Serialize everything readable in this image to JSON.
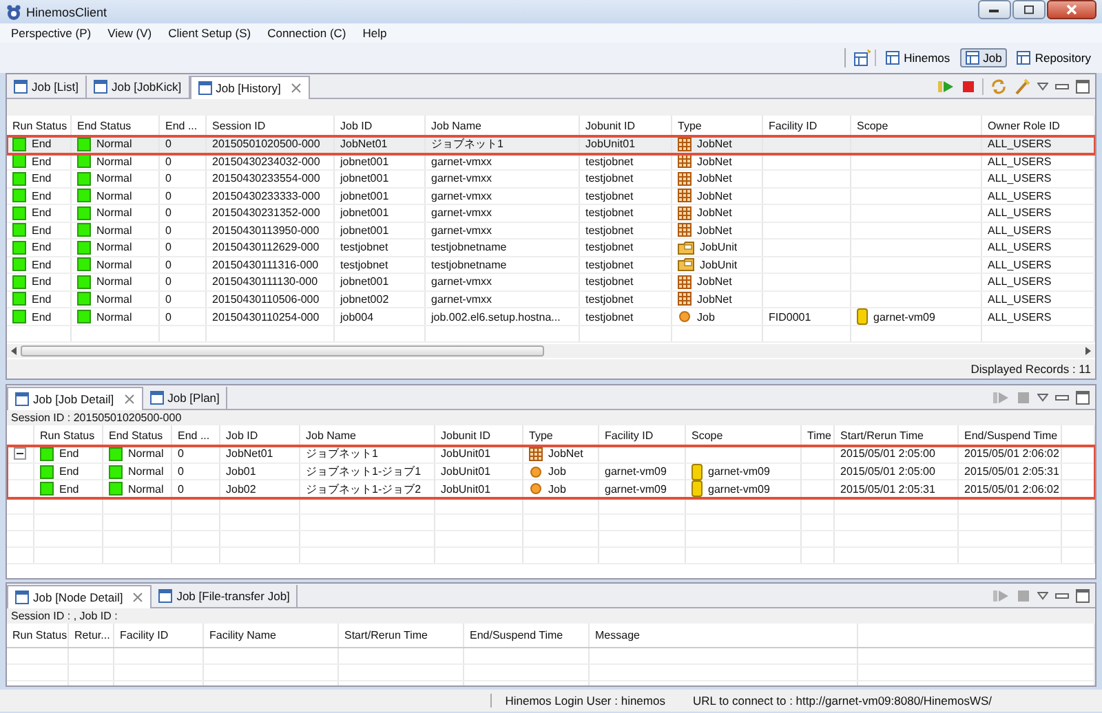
{
  "window": {
    "title": "HinemosClient"
  },
  "menu": [
    "Perspective (P)",
    "View (V)",
    "Client Setup (S)",
    "Connection (C)",
    "Help"
  ],
  "perspectives": [
    {
      "label": "Hinemos",
      "selected": false
    },
    {
      "label": "Job",
      "selected": true
    },
    {
      "label": "Repository",
      "selected": false
    }
  ],
  "history": {
    "tabs": [
      {
        "label": "Job [List]",
        "selected": false
      },
      {
        "label": "Job [JobKick]",
        "selected": false
      },
      {
        "label": "Job [History]",
        "selected": true
      }
    ],
    "columns": [
      "Run Status",
      "End Status",
      "End ...",
      "Session ID",
      "Job ID",
      "Job Name",
      "Jobunit ID",
      "Type",
      "Facility ID",
      "Scope",
      "Owner Role ID"
    ],
    "rows": [
      {
        "run_status": "End",
        "end_status": "Normal",
        "end_value": "0",
        "session_id": "20150501020500-000",
        "job_id": "JobNet01",
        "job_name": "ジョブネット1",
        "jobunit_id": "JobUnit01",
        "kind": "jobnet",
        "type": "JobNet",
        "owner_role_id": "ALL_USERS",
        "selected": true
      },
      {
        "run_status": "End",
        "end_status": "Normal",
        "end_value": "0",
        "session_id": "20150430234032-000",
        "job_id": "jobnet001",
        "job_name": "garnet-vmxx",
        "jobunit_id": "testjobnet",
        "kind": "jobnet",
        "type": "JobNet",
        "owner_role_id": "ALL_USERS",
        "selected": false
      },
      {
        "run_status": "End",
        "end_status": "Normal",
        "end_value": "0",
        "session_id": "20150430233554-000",
        "job_id": "jobnet001",
        "job_name": "garnet-vmxx",
        "jobunit_id": "testjobnet",
        "kind": "jobnet",
        "type": "JobNet",
        "owner_role_id": "ALL_USERS",
        "selected": false
      },
      {
        "run_status": "End",
        "end_status": "Normal",
        "end_value": "0",
        "session_id": "20150430233333-000",
        "job_id": "jobnet001",
        "job_name": "garnet-vmxx",
        "jobunit_id": "testjobnet",
        "kind": "jobnet",
        "type": "JobNet",
        "owner_role_id": "ALL_USERS",
        "selected": false
      },
      {
        "run_status": "End",
        "end_status": "Normal",
        "end_value": "0",
        "session_id": "20150430231352-000",
        "job_id": "jobnet001",
        "job_name": "garnet-vmxx",
        "jobunit_id": "testjobnet",
        "kind": "jobnet",
        "type": "JobNet",
        "owner_role_id": "ALL_USERS",
        "selected": false
      },
      {
        "run_status": "End",
        "end_status": "Normal",
        "end_value": "0",
        "session_id": "20150430113950-000",
        "job_id": "jobnet001",
        "job_name": "garnet-vmxx",
        "jobunit_id": "testjobnet",
        "kind": "jobnet",
        "type": "JobNet",
        "owner_role_id": "ALL_USERS",
        "selected": false
      },
      {
        "run_status": "End",
        "end_status": "Normal",
        "end_value": "0",
        "session_id": "20150430112629-000",
        "job_id": "testjobnet",
        "job_name": "testjobnetname",
        "jobunit_id": "testjobnet",
        "kind": "jobunit",
        "type": "JobUnit",
        "owner_role_id": "ALL_USERS",
        "selected": false
      },
      {
        "run_status": "End",
        "end_status": "Normal",
        "end_value": "0",
        "session_id": "20150430111316-000",
        "job_id": "testjobnet",
        "job_name": "testjobnetname",
        "jobunit_id": "testjobnet",
        "kind": "jobunit",
        "type": "JobUnit",
        "owner_role_id": "ALL_USERS",
        "selected": false
      },
      {
        "run_status": "End",
        "end_status": "Normal",
        "end_value": "0",
        "session_id": "20150430111130-000",
        "job_id": "jobnet001",
        "job_name": "garnet-vmxx",
        "jobunit_id": "testjobnet",
        "kind": "jobnet",
        "type": "JobNet",
        "owner_role_id": "ALL_USERS",
        "selected": false
      },
      {
        "run_status": "End",
        "end_status": "Normal",
        "end_value": "0",
        "session_id": "20150430110506-000",
        "job_id": "jobnet002",
        "job_name": "garnet-vmxx",
        "jobunit_id": "testjobnet",
        "kind": "jobnet",
        "type": "JobNet",
        "owner_role_id": "ALL_USERS",
        "selected": false
      },
      {
        "run_status": "End",
        "end_status": "Normal",
        "end_value": "0",
        "session_id": "20150430110254-000",
        "job_id": "job004",
        "job_name": "job.002.el6.setup.hostna...",
        "jobunit_id": "testjobnet",
        "kind": "job",
        "type": "Job",
        "facility_id": "FID0001",
        "scope": "garnet-vm09",
        "owner_role_id": "ALL_USERS",
        "selected": false
      }
    ],
    "footer": "Displayed Records : 11"
  },
  "detail": {
    "tabs": [
      {
        "label": "Job [Job Detail]",
        "selected": true
      },
      {
        "label": "Job [Plan]",
        "selected": false
      }
    ],
    "session_label": "Session ID : 20150501020500-000",
    "columns": [
      "Run Status",
      "End Status",
      "End ...",
      "Job ID",
      "Job Name",
      "Jobunit ID",
      "Type",
      "Facility ID",
      "Scope",
      "Time",
      "Start/Rerun Time",
      "End/Suspend Time"
    ],
    "highlighted": true,
    "rows": [
      {
        "run_status": "End",
        "end_status": "Normal",
        "end_value": "0",
        "job_id": "JobNet01",
        "job_name": "ジョブネット1",
        "jobunit_id": "JobUnit01",
        "kind": "jobnet",
        "type": "JobNet",
        "start_time": "2015/05/01 2:05:00",
        "end_time": "2015/05/01 2:06:02",
        "expanded": true,
        "children": [
          {
            "run_status": "End",
            "end_status": "Normal",
            "end_value": "0",
            "job_id": "Job01",
            "job_name": "ジョブネット1-ジョブ1",
            "jobunit_id": "JobUnit01",
            "kind": "job",
            "type": "Job",
            "facility_id": "garnet-vm09",
            "scope": "garnet-vm09",
            "start_time": "2015/05/01 2:05:00",
            "end_time": "2015/05/01 2:05:31"
          },
          {
            "run_status": "End",
            "end_status": "Normal",
            "end_value": "0",
            "job_id": "Job02",
            "job_name": "ジョブネット1-ジョブ2",
            "jobunit_id": "JobUnit01",
            "kind": "job",
            "type": "Job",
            "facility_id": "garnet-vm09",
            "scope": "garnet-vm09",
            "start_time": "2015/05/01 2:05:31",
            "end_time": "2015/05/01 2:06:02"
          }
        ]
      }
    ]
  },
  "node_detail": {
    "tabs": [
      {
        "label": "Job [Node Detail]",
        "selected": true
      },
      {
        "label": "Job [File-transfer Job]",
        "selected": false
      }
    ],
    "session_label": "Session ID : ,   Job ID :",
    "columns": [
      "Run Status",
      "Retur...",
      "Facility ID",
      "Facility Name",
      "Start/Rerun Time",
      "End/Suspend Time",
      "Message"
    ]
  },
  "status_bar": {
    "login_user": "Hinemos Login User : hinemos",
    "url": "URL to connect to : http://garnet-vm09:8080/HinemosWS/"
  }
}
